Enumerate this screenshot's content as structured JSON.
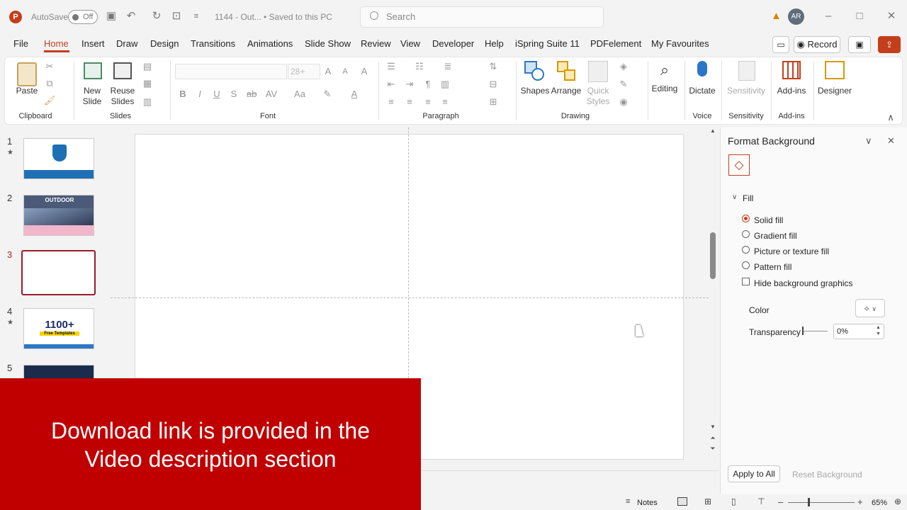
{
  "titlebar": {
    "autosave_label": "AutoSave",
    "autosave_state": "Off",
    "doc_title": "1144 - Out...",
    "save_status": "• Saved to this PC",
    "search_placeholder": "Search",
    "user_initials": "AR"
  },
  "menu": {
    "tabs": [
      "File",
      "Home",
      "Insert",
      "Draw",
      "Design",
      "Transitions",
      "Animations",
      "Slide Show",
      "Review",
      "View",
      "Developer",
      "Help",
      "iSpring Suite 11",
      "PDFelement",
      "My Favourites"
    ],
    "active": "Home",
    "record_label": "Record"
  },
  "ribbon": {
    "paste": "Paste",
    "new_slide": "New Slide",
    "reuse_slides": "Reuse Slides",
    "font_size": "28+",
    "shapes": "Shapes",
    "arrange": "Arrange",
    "quick_styles": "Quick Styles",
    "editing": "Editing",
    "dictate": "Dictate",
    "sensitivity": "Sensitivity",
    "add_ins": "Add-ins",
    "designer": "Designer",
    "groups": {
      "clipboard": "Clipboard",
      "slides": "Slides",
      "font": "Font",
      "paragraph": "Paragraph",
      "drawing": "Drawing",
      "voice": "Voice",
      "sensitivity": "Sensitivity",
      "add_ins": "Add-ins"
    }
  },
  "slides": {
    "numbers": [
      "1",
      "2",
      "3",
      "4",
      "5"
    ],
    "thumb2_title": "OUTDOOR",
    "thumb4_big": "1100+",
    "thumb4_sub": "Free Templates",
    "selected": 3
  },
  "pane": {
    "title": "Format Background",
    "section": "Fill",
    "options": [
      "Solid fill",
      "Gradient fill",
      "Picture or texture fill",
      "Pattern fill"
    ],
    "selected_option": "Solid fill",
    "hide_bg": "Hide background graphics",
    "color_label": "Color",
    "transparency_label": "Transparency",
    "transparency_value": "0%",
    "apply_all": "Apply to All",
    "reset": "Reset Background"
  },
  "overlay": {
    "line1": "Download link is provided in the",
    "line2": "Video description section"
  },
  "status": {
    "notes": "Notes",
    "zoom": "65%"
  },
  "colors": {
    "accent": "#c43e1c",
    "banner": "#c00000"
  }
}
